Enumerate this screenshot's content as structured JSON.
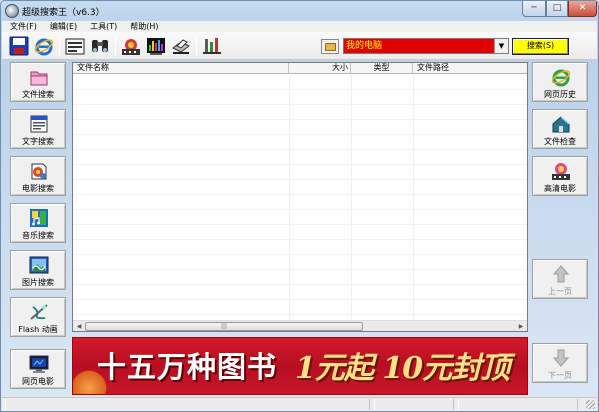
{
  "window": {
    "title": "超级搜索王（v6.3）",
    "controls": {
      "minimize": "─",
      "maximize": "□",
      "close": "✕"
    }
  },
  "menu": [
    {
      "label": "文件(F)"
    },
    {
      "label": "编辑(E)"
    },
    {
      "label": "工具(T)"
    },
    {
      "label": "帮助(H)"
    }
  ],
  "toolbar": {
    "location_value": "我的电脑",
    "search_label": "搜索(S)",
    "icons": [
      "save-icon",
      "ie-icon",
      "tape-icon",
      "binoculars-icon",
      "film-icon",
      "equalizer-icon",
      "scanner-icon",
      "tools-icon"
    ]
  },
  "left_panel": [
    {
      "label": "文件搜索",
      "icon": "folder-icon"
    },
    {
      "label": "文字搜索",
      "icon": "document-icon"
    },
    {
      "label": "电影搜索",
      "icon": "film-reel-icon"
    },
    {
      "label": "音乐搜索",
      "icon": "music-icon"
    },
    {
      "label": "图片搜索",
      "icon": "picture-icon"
    },
    {
      "label": "Flash 动画",
      "icon": "flash-icon"
    },
    {
      "label": "网页电影",
      "icon": "monitor-icon"
    }
  ],
  "right_panel": [
    {
      "label": "网页历史",
      "icon": "ie-icon"
    },
    {
      "label": "文件检查",
      "icon": "house-icon"
    },
    {
      "label": "高清电影",
      "icon": "hd-film-icon"
    },
    {
      "label": "上一页",
      "icon": "up-arrow-icon",
      "enabled": false
    },
    {
      "label": "下一页",
      "icon": "down-arrow-icon",
      "enabled": false
    }
  ],
  "results": {
    "columns": [
      "文件名称",
      "大小",
      "类型",
      "文件路径"
    ],
    "rows": []
  },
  "banner": {
    "text1": "十五万种图书",
    "text2": "1元起 10元封顶"
  },
  "colors": {
    "location_bg": "#e00000",
    "location_text": "#ffff00",
    "search_button": "#ffff00",
    "banner_bg": "#c3142a"
  }
}
